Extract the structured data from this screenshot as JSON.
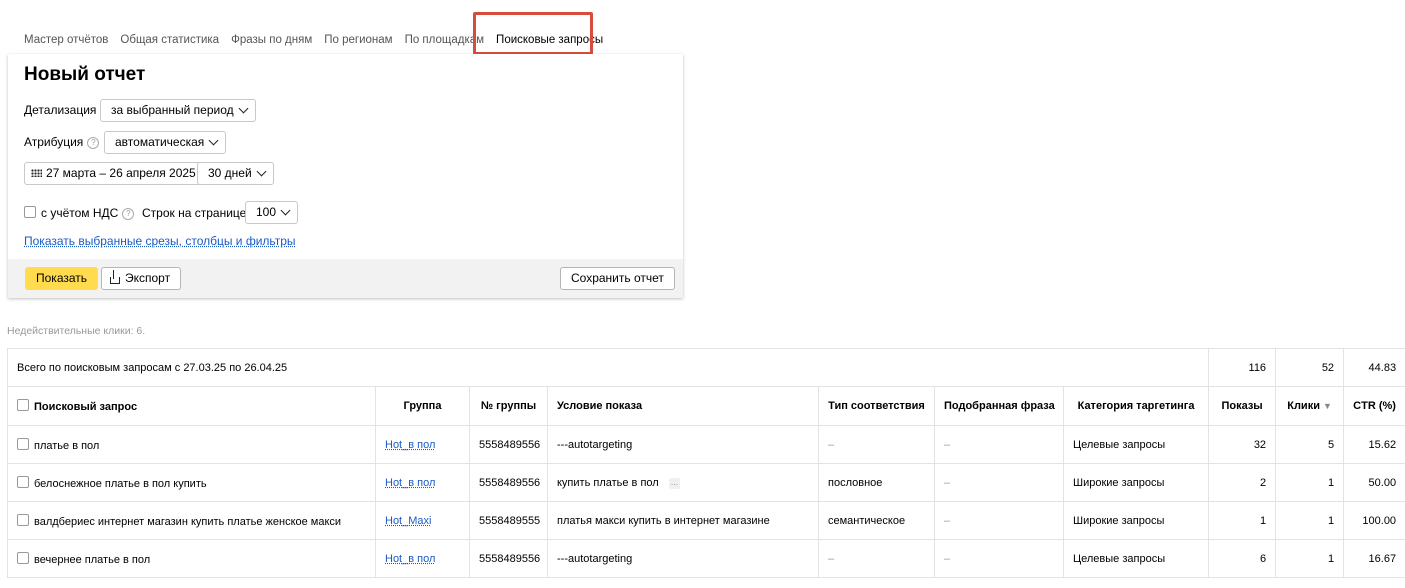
{
  "tabs": [
    {
      "label": "Мастер отчётов"
    },
    {
      "label": "Общая статистика"
    },
    {
      "label": "Фразы по дням"
    },
    {
      "label": "По регионам"
    },
    {
      "label": "По площадкам"
    },
    {
      "label": "Поисковые запросы",
      "active": true
    }
  ],
  "report": {
    "title": "Новый отчет",
    "detail_label": "Детализация",
    "detail_value": "за выбранный период",
    "attribution_label": "Атрибуция",
    "attribution_value": "автоматическая",
    "date_range": "27 марта – 26 апреля 2025",
    "period_value": "30 дней",
    "vat_label": "с учётом НДС",
    "rows_label": "Строк на странице",
    "rows_value": "100",
    "show_filters_link": "Показать выбранные срезы, столбцы и фильтры",
    "show_button": "Показать",
    "export_button": "Экспорт",
    "save_button": "Сохранить отчет"
  },
  "invalid_clicks": "Недействительные клики: 6.",
  "table": {
    "total": {
      "label": "Всего по поисковым запросам с 27.03.25 по 26.04.25",
      "shows": "116",
      "clicks": "52",
      "ctr": "44.83"
    },
    "headers": {
      "query": "Поисковый запрос",
      "group": "Группа",
      "group_no": "№ группы",
      "condition": "Условие показа",
      "match_type": "Тип соответствия",
      "matched_phrase": "Подобранная фраза",
      "category": "Категория таргетинга",
      "shows": "Показы",
      "clicks": "Клики",
      "ctr": "CTR (%)"
    },
    "rows": [
      {
        "query": "платье в пол",
        "group": "Hot_в пол",
        "group_no": "5558489556",
        "condition": "---autotargeting",
        "match_type": "–",
        "matched_phrase": "–",
        "category": "Целевые запросы",
        "shows": "32",
        "clicks": "5",
        "ctr": "15.62"
      },
      {
        "query": "белоснежное платье в пол купить",
        "group": "Hot_в пол",
        "group_no": "5558489556",
        "condition": "купить платье в пол",
        "match_type": "пословное",
        "matched_phrase": "–",
        "category": "Широкие запросы",
        "shows": "2",
        "clicks": "1",
        "ctr": "50.00"
      },
      {
        "query": "валдбериес интернет магазин купить платье женское макси",
        "group": "Hot_Maxi",
        "group_no": "5558489555",
        "condition": "платья макси купить в интернет магазине",
        "match_type": "семантическое",
        "matched_phrase": "–",
        "category": "Широкие запросы",
        "shows": "1",
        "clicks": "1",
        "ctr": "100.00"
      },
      {
        "query": "вечернее платье в пол",
        "group": "Hot_в пол",
        "group_no": "5558489556",
        "condition": "---autotargeting",
        "match_type": "–",
        "matched_phrase": "–",
        "category": "Целевые запросы",
        "shows": "6",
        "clicks": "1",
        "ctr": "16.67"
      }
    ]
  },
  "colors": {
    "accent_yellow": "#ffdb4d",
    "link_blue": "#1a5bc6",
    "highlight_red": "#d64d3f"
  }
}
